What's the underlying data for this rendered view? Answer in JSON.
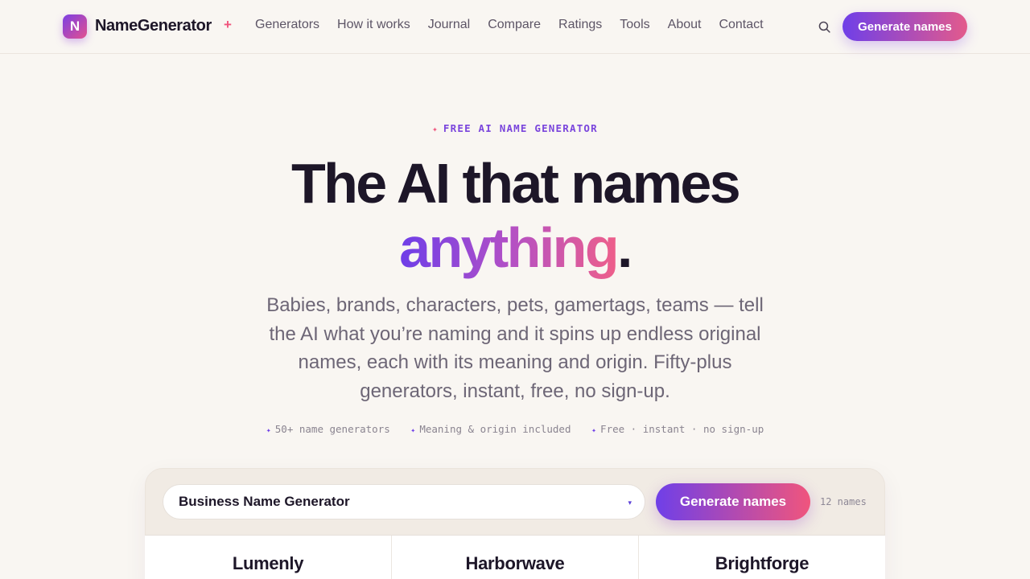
{
  "brand": {
    "mark": "N",
    "name": "NameGenerator",
    "plus": "+"
  },
  "nav": {
    "links": [
      "Generators",
      "How it works",
      "Journal",
      "Compare",
      "Ratings",
      "Tools",
      "About",
      "Contact"
    ],
    "search_icon": "search-icon",
    "cta": "Generate names"
  },
  "hero": {
    "eyebrow_spark": "✦",
    "eyebrow": "FREE AI NAME GENERATOR",
    "title_line1": "The AI that names",
    "title_accent": "anything",
    "title_dot": ".",
    "lede": "Babies, brands, characters, pets, gamertags, teams — tell the AI what you’re naming and it spins up endless original names, each with its meaning and origin. Fifty-plus generators, instant, free, no sign-up.",
    "features": [
      "50+ name generators",
      "Meaning & origin included",
      "Free · instant · no sign-up"
    ],
    "feature_spark": "✦"
  },
  "generator": {
    "selected": "Business Name Generator",
    "caret": "▾",
    "button": "Generate names",
    "count": "12 names",
    "results": [
      "Lumenly",
      "Harborwave",
      "Brightforge"
    ]
  },
  "colors": {
    "accent_purple": "#6f3fe8",
    "accent_pink": "#f0557d",
    "background": "#f9f6f2",
    "ink": "#1d1628"
  }
}
